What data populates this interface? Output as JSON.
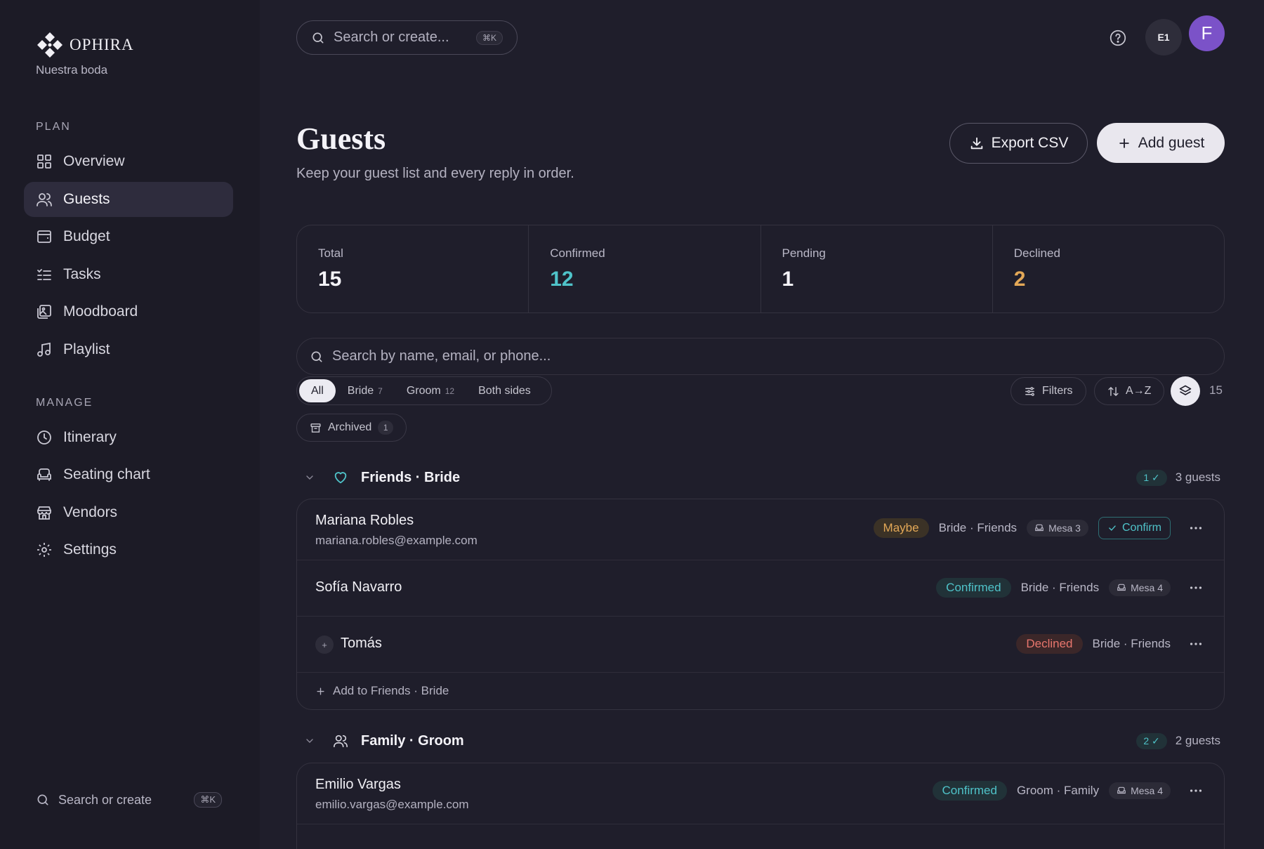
{
  "app": {
    "name": "OPHIRA",
    "workspace": "Nuestra boda"
  },
  "sidebar": {
    "plan_label": "PLAN",
    "manage_label": "MANAGE",
    "plan_items": [
      {
        "label": "Overview",
        "icon": "grid-icon"
      },
      {
        "label": "Guests",
        "icon": "users-icon",
        "active": true
      },
      {
        "label": "Budget",
        "icon": "wallet-icon"
      },
      {
        "label": "Tasks",
        "icon": "checklist-icon"
      },
      {
        "label": "Moodboard",
        "icon": "image-icon"
      },
      {
        "label": "Playlist",
        "icon": "music-icon"
      }
    ],
    "manage_items": [
      {
        "label": "Itinerary",
        "icon": "clock-icon"
      },
      {
        "label": "Seating chart",
        "icon": "armchair-icon"
      },
      {
        "label": "Vendors",
        "icon": "store-icon"
      },
      {
        "label": "Settings",
        "icon": "gear-icon"
      }
    ],
    "search_label": "Search or create",
    "search_shortcut": "⌘K"
  },
  "topbar": {
    "search_placeholder": "Search or create...",
    "search_shortcut": "⌘K",
    "workspace_badge": "E1",
    "avatar_initial": "F"
  },
  "header": {
    "title": "Guests",
    "subtitle": "Keep your guest list and every reply in order.",
    "export_label": "Export CSV",
    "add_label": "Add guest"
  },
  "stats": [
    {
      "label": "Total",
      "value": "15",
      "color": "#f4f3f8"
    },
    {
      "label": "Confirmed",
      "value": "12",
      "color": "#4fc3c9"
    },
    {
      "label": "Pending",
      "value": "1",
      "color": "#f4f3f8"
    },
    {
      "label": "Declined",
      "value": "2",
      "color": "#e3a857"
    }
  ],
  "guest_search": {
    "placeholder": "Search by name, email, or phone..."
  },
  "filters": {
    "segments": [
      {
        "label": "All",
        "count": ""
      },
      {
        "label": "Bride",
        "count": "7"
      },
      {
        "label": "Groom",
        "count": "12"
      },
      {
        "label": "Both sides",
        "count": ""
      }
    ],
    "filters_label": "Filters",
    "sort_label": "A→Z",
    "result_count": "15",
    "archived_label": "Archived",
    "archived_count": "1"
  },
  "groups": [
    {
      "title": "Friends · Bride",
      "icon": "heart-icon",
      "confirmed_badge": "1 ✓",
      "guest_count": "3 guests",
      "add_label": "Add to Friends · Bride",
      "guests": [
        {
          "name": "Mariana Robles",
          "email": "mariana.robles@example.com",
          "status": "Maybe",
          "side": "Bride · Friends",
          "table": "Mesa 3",
          "confirm_label": "Confirm"
        },
        {
          "name": "Sofía Navarro",
          "email": "",
          "status": "Confirmed",
          "side": "Bride · Friends",
          "table": "Mesa 4"
        },
        {
          "name": "Tomás",
          "email": "",
          "status": "Declined",
          "side": "Bride · Friends",
          "table": ""
        }
      ]
    },
    {
      "title": "Family · Groom",
      "icon": "users-icon",
      "confirmed_badge": "2 ✓",
      "guest_count": "2 guests",
      "guests": [
        {
          "name": "Emilio Vargas",
          "email": "emilio.vargas@example.com",
          "status": "Confirmed",
          "side": "Groom · Family",
          "table": "Mesa 4"
        }
      ]
    }
  ],
  "colors": {
    "accent_teal": "#4fc3c9",
    "accent_amber": "#e3a857",
    "accent_red": "#e8766d",
    "avatar": "#7b52c8"
  }
}
